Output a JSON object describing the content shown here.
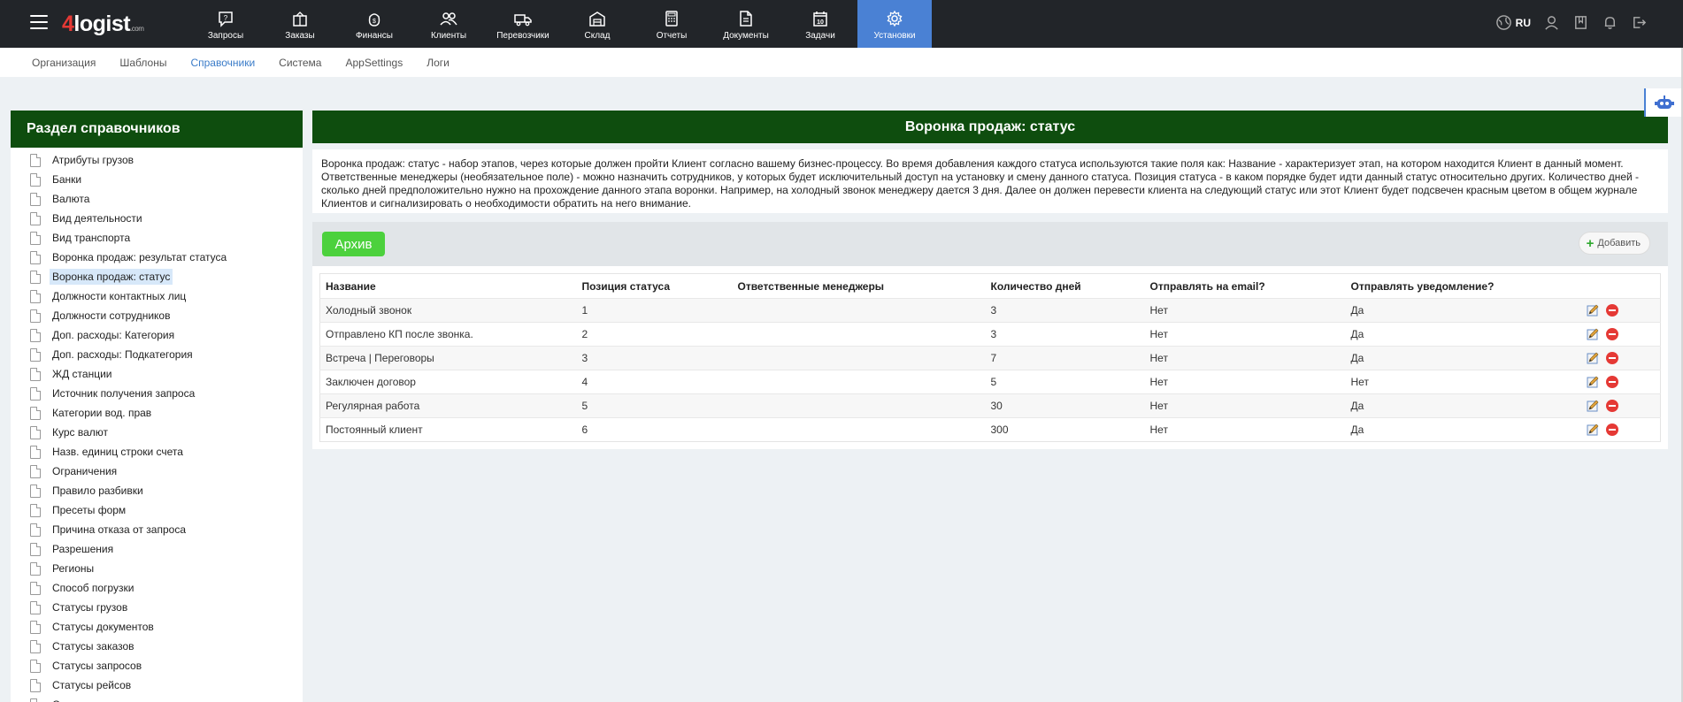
{
  "logo": {
    "brand_num": "4",
    "brand_text": "logist",
    "brand_suffix": ".com"
  },
  "nav": [
    {
      "label": "Запросы",
      "icon": "requests-icon"
    },
    {
      "label": "Заказы",
      "icon": "orders-icon"
    },
    {
      "label": "Финансы",
      "icon": "finance-icon"
    },
    {
      "label": "Клиенты",
      "icon": "clients-icon"
    },
    {
      "label": "Перевозчики",
      "icon": "truck-icon"
    },
    {
      "label": "Склад",
      "icon": "warehouse-icon"
    },
    {
      "label": "Отчеты",
      "icon": "calculator-icon"
    },
    {
      "label": "Документы",
      "icon": "document-icon"
    },
    {
      "label": "Задачи",
      "icon": "calendar-icon"
    },
    {
      "label": "Установки",
      "icon": "gear-icon",
      "active": true
    }
  ],
  "topright": {
    "lang": "RU"
  },
  "subnav": [
    {
      "label": "Организация"
    },
    {
      "label": "Шаблоны"
    },
    {
      "label": "Справочники",
      "active": true
    },
    {
      "label": "Система"
    },
    {
      "label": "AppSettings"
    },
    {
      "label": "Логи"
    }
  ],
  "left_panel": {
    "title": "Раздел справочников",
    "items": [
      "Атрибуты грузов",
      "Банки",
      "Валюта",
      "Вид деятельности",
      "Вид транспорта",
      "Воронка продаж: результат статуса",
      "Воронка продаж: статус",
      "Должности контактных лиц",
      "Должности сотрудников",
      "Доп. расходы: Категория",
      "Доп. расходы: Подкатегория",
      "ЖД станции",
      "Источник получения запроса",
      "Категории вод. прав",
      "Курс валют",
      "Назв. единиц строки счета",
      "Ограничения",
      "Правило разбивки",
      "Пресеты форм",
      "Причина отказа от запроса",
      "Разрешения",
      "Регионы",
      "Способ погрузки",
      "Статусы грузов",
      "Статусы документов",
      "Статусы заказов",
      "Статусы запросов",
      "Статусы рейсов",
      "Страны"
    ],
    "selected_index": 6
  },
  "main": {
    "title": "Воронка продаж: статус",
    "description": "Воронка продаж: статус - набор этапов, через которые должен пройти Клиент согласно вашему бизнес-процессу. Во время добавления каждого статуса используются такие поля как: Название - характеризует этап, на котором находится Клиент в данный момент. Ответственные менеджеры (необязательное поле) - можно назначить сотрудников, у которых будет исключительный доступ на установку и смену данного статуса. Позиция статуса - в каком порядке будет идти данный статус относительно других. Количество дней - сколько дней предположительно нужно на прохождение данного этапа воронки. Например, на холодный звонок менеджеру дается 3 дня. Далее он должен перевести клиента на следующий статус или этот Клиент будет подсвечен красным цветом в общем журнале Клиентов и сигнализировать о необходимости обратить на него внимание.",
    "archive_label": "Архив",
    "add_label": "Добавить",
    "table": {
      "headers": [
        "Название",
        "Позиция статуса",
        "Ответственные менеджеры",
        "Количество дней",
        "Отправлять на email?",
        "Отправлять уведомление?"
      ],
      "rows": [
        [
          "Холодный звонок",
          "1",
          "",
          "3",
          "Нет",
          "Да"
        ],
        [
          "Отправлено КП после звонка.",
          "2",
          "",
          "3",
          "Нет",
          "Да"
        ],
        [
          "Встреча | Переговоры",
          "3",
          "",
          "7",
          "Нет",
          "Да"
        ],
        [
          "Заключен договор",
          "4",
          "",
          "5",
          "Нет",
          "Нет"
        ],
        [
          "Регулярная работа",
          "5",
          "",
          "30",
          "Нет",
          "Да"
        ],
        [
          "Постоянный клиент",
          "6",
          "",
          "300",
          "Нет",
          "Да"
        ]
      ]
    }
  },
  "colors": {
    "header_green": "#0e4d0e",
    "active_blue": "#4a81d4",
    "archive_green": "#4cd13d",
    "delete_red": "#e53935"
  }
}
